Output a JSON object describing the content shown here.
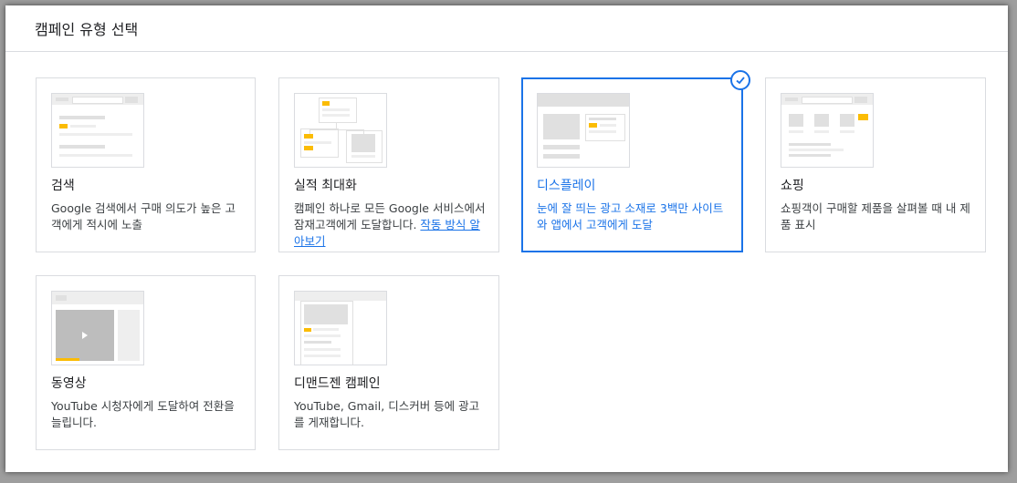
{
  "header": {
    "title": "캠페인 유형 선택"
  },
  "cards": [
    {
      "title": "검색",
      "desc": "Google 검색에서 구매 의도가 높은 고객에게 적시에 노출"
    },
    {
      "title": "실적 최대화",
      "desc": "캠페인 하나로 모든 Google 서비스에서 잠재고객에게 도달합니다. ",
      "link": "작동 방식 알아보기"
    },
    {
      "title": "디스플레이",
      "desc": "눈에 잘 띄는 광고 소재로 3백만 사이트와 앱에서 고객에게 도달",
      "selected": true
    },
    {
      "title": "쇼핑",
      "desc": "쇼핑객이 구매할 제품을 살펴볼 때 내 제품 표시"
    },
    {
      "title": "동영상",
      "desc": "YouTube 시청자에게 도달하여 전환을 늘립니다."
    },
    {
      "title": "디맨드젠 캠페인",
      "desc": "YouTube, Gmail, 디스커버 등에 광고를 게재합니다."
    }
  ],
  "colors": {
    "accent": "#1a73e8",
    "highlight": "#fbbc04",
    "border": "#dadce0"
  },
  "icons": {
    "selected": "check-circle-icon"
  }
}
